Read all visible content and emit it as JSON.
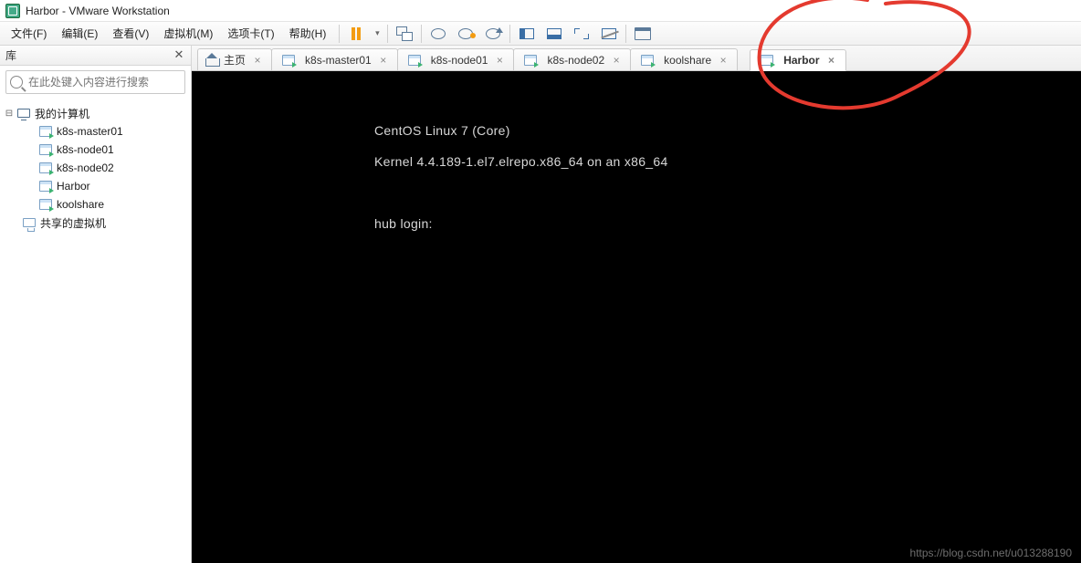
{
  "window": {
    "title": "Harbor - VMware Workstation"
  },
  "menu": {
    "file": "文件(F)",
    "edit": "编辑(E)",
    "view": "查看(V)",
    "vm": "虚拟机(M)",
    "tabs": "选项卡(T)",
    "help": "帮助(H)"
  },
  "sidebar": {
    "title": "库",
    "searchPlaceholder": "在此处键入内容进行搜索",
    "root": "我的计算机",
    "vms": [
      {
        "label": "k8s-master01"
      },
      {
        "label": "k8s-node01"
      },
      {
        "label": "k8s-node02"
      },
      {
        "label": "Harbor"
      },
      {
        "label": "koolshare"
      }
    ],
    "shared": "共享的虚拟机"
  },
  "tabs": {
    "home": "主页",
    "items": [
      {
        "label": "k8s-master01"
      },
      {
        "label": "k8s-node01"
      },
      {
        "label": "k8s-node02"
      },
      {
        "label": "koolshare"
      },
      {
        "label": "Harbor"
      }
    ]
  },
  "terminal": {
    "line1": "CentOS Linux 7 (Core)",
    "line2": "Kernel 4.4.189-1.el7.elrepo.x86_64 on an x86_64",
    "prompt": "hub login:"
  },
  "watermark": "https://blog.csdn.net/u013288190"
}
